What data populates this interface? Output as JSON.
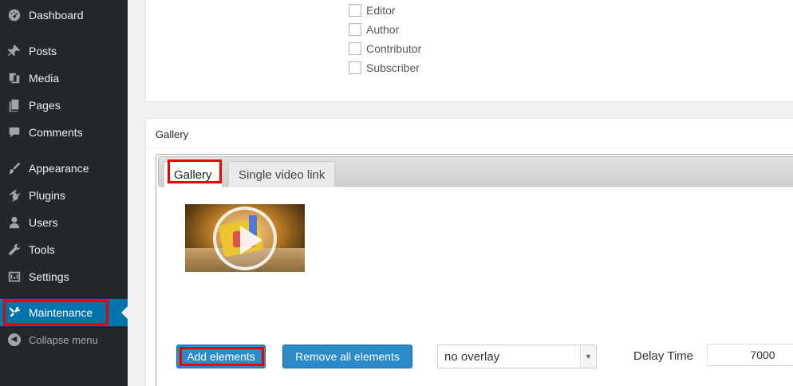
{
  "sidebar": {
    "items": [
      {
        "label": "Dashboard",
        "icon": "dashboard-icon"
      },
      {
        "label": "Posts",
        "icon": "pin-icon"
      },
      {
        "label": "Media",
        "icon": "media-icon"
      },
      {
        "label": "Pages",
        "icon": "pages-icon"
      },
      {
        "label": "Comments",
        "icon": "comment-icon"
      },
      {
        "label": "Appearance",
        "icon": "brush-icon"
      },
      {
        "label": "Plugins",
        "icon": "plugin-icon"
      },
      {
        "label": "Users",
        "icon": "user-icon"
      },
      {
        "label": "Tools",
        "icon": "wrench-icon"
      },
      {
        "label": "Settings",
        "icon": "settings-icon"
      },
      {
        "label": "Maintenance",
        "icon": "tools-icon"
      }
    ],
    "collapse_label": "Collapse menu"
  },
  "roles": {
    "editor": "Editor",
    "author": "Author",
    "contributor": "Contributor",
    "subscriber": "Subscriber"
  },
  "gallery_panel": {
    "title": "Gallery",
    "tabs": [
      {
        "label": "Gallery"
      },
      {
        "label": "Single video link"
      }
    ],
    "add_button": "Add elements",
    "remove_button": "Remove all elements",
    "overlay_select": "no overlay",
    "delay_label": "Delay Time",
    "delay_value": "7000"
  },
  "colors": {
    "sidebar_bg": "#23282d",
    "active_blue": "#0073aa",
    "button_blue": "#2a8bc8",
    "highlight_red": "#e00000"
  }
}
